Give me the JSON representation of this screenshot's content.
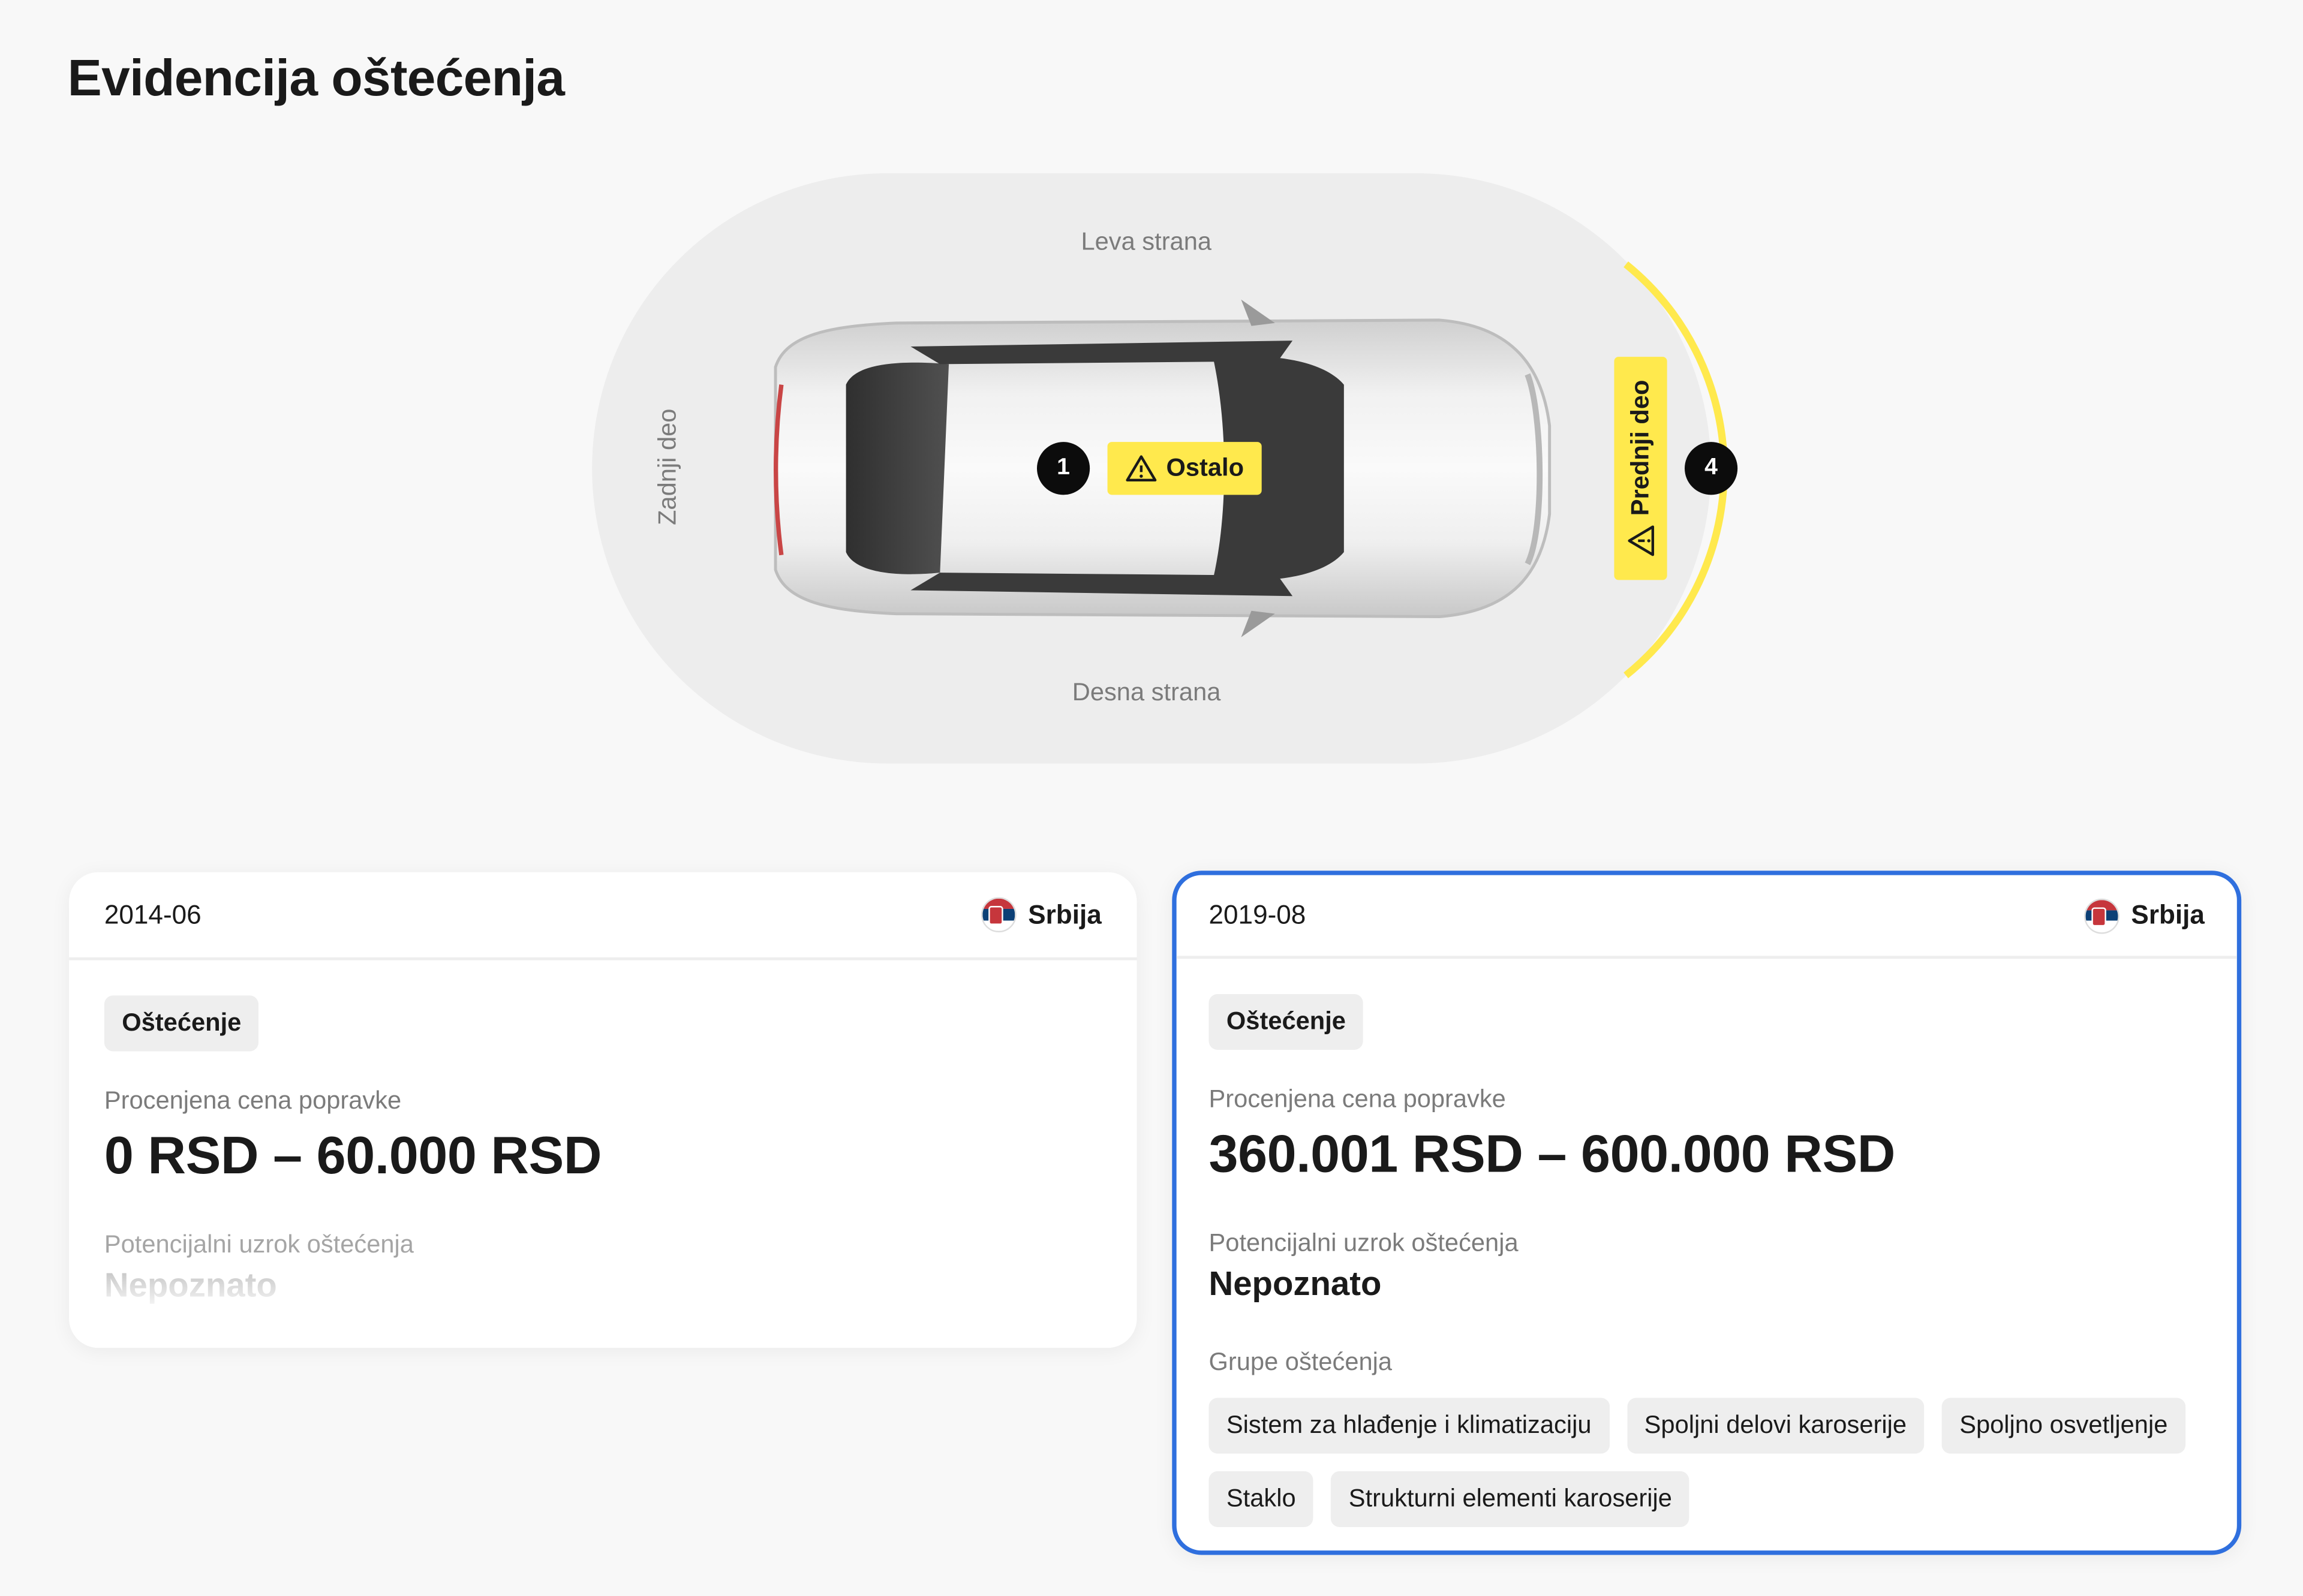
{
  "page": {
    "title": "Evidencija oštećenja"
  },
  "diagram": {
    "left_side": "Leva strana",
    "right_side": "Desna strana",
    "rear": "Zadnji deo",
    "front_tag": "Prednji deo",
    "front_count": "4",
    "center_tag": "Ostalo",
    "center_count": "1",
    "accent_color": "#ffe94d"
  },
  "records": [
    {
      "date": "2014-06",
      "country": "Srbija",
      "badge": "Oštećenje",
      "price_label": "Procenjena cena popravke",
      "price": "0 RSD – 60.000 RSD",
      "cause_label": "Potencijalni uzrok oštećenja",
      "cause": "Nepoznato"
    },
    {
      "date": "2019-08",
      "country": "Srbija",
      "badge": "Oštećenje",
      "price_label": "Procenjena cena popravke",
      "price": "360.001 RSD – 600.000 RSD",
      "cause_label": "Potencijalni uzrok oštećenja",
      "cause": "Nepoznato",
      "groups_label": "Grupe oštećenja",
      "groups": [
        "Sistem za hlađenje i klimatizaciju",
        "Spoljni delovi karoserije",
        "Spoljno osvetljenje",
        "Staklo",
        "Strukturni elementi karoserije"
      ]
    }
  ]
}
